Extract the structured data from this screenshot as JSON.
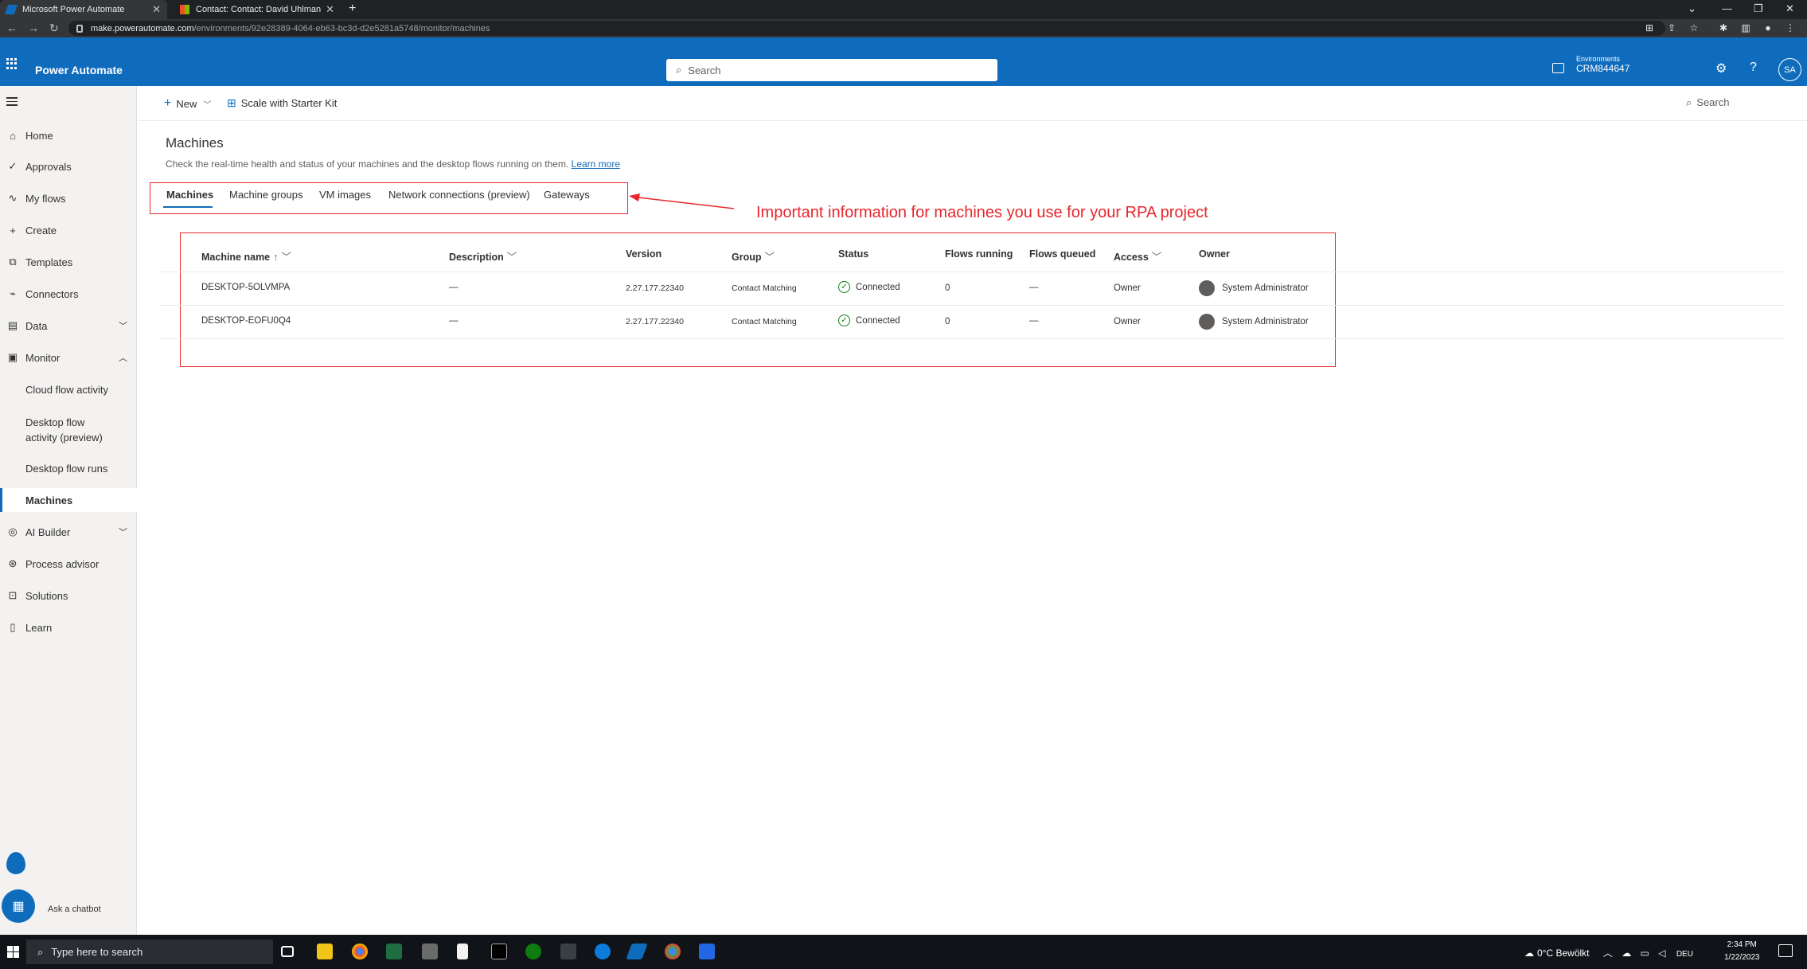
{
  "browser": {
    "tabs": [
      {
        "title": "Microsoft Power Automate",
        "active": true
      },
      {
        "title": "Contact: Contact: David Uhlmann",
        "active": false
      }
    ],
    "url_host": "make.powerautomate.com",
    "url_path": "/environments/92e28389-4064-eb63-bc3d-d2e5281a5748/monitor/machines"
  },
  "header": {
    "app_name": "Power Automate",
    "search_placeholder": "Search",
    "env_label": "Environments",
    "env_value": "CRM844647",
    "avatar_initials": "SA",
    "accent_color": "#0f6cbd"
  },
  "sidebar": {
    "items": [
      {
        "label": "Home",
        "icon": "home-icon"
      },
      {
        "label": "Approvals",
        "icon": "approvals-icon"
      },
      {
        "label": "My flows",
        "icon": "flows-icon"
      },
      {
        "label": "Create",
        "icon": "plus-icon"
      },
      {
        "label": "Templates",
        "icon": "templates-icon"
      },
      {
        "label": "Connectors",
        "icon": "connectors-icon"
      },
      {
        "label": "Data",
        "icon": "data-icon"
      },
      {
        "label": "Monitor",
        "icon": "monitor-icon"
      },
      {
        "label": "Cloud flow activity"
      },
      {
        "label": "Desktop flow activity (preview)"
      },
      {
        "label": "Desktop flow runs"
      },
      {
        "label": "Machines"
      },
      {
        "label": "AI Builder",
        "icon": "ai-builder-icon"
      },
      {
        "label": "Process advisor",
        "icon": "process-advisor-icon"
      },
      {
        "label": "Solutions",
        "icon": "solutions-icon"
      },
      {
        "label": "Learn",
        "icon": "learn-icon"
      }
    ],
    "chatbot_label": "Ask a chatbot"
  },
  "commandbar": {
    "new_label": "New",
    "starter_kit_label": "Scale with Starter Kit",
    "search_label": "Search"
  },
  "main": {
    "title": "Machines",
    "subtitle": "Check the real-time health and status of your machines and the desktop flows running on them.",
    "learn_more": "Learn more",
    "tabs": [
      "Machines",
      "Machine groups",
      "VM images",
      "Network connections (preview)",
      "Gateways"
    ],
    "annotation": "Important information for machines you use for your RPA project",
    "table": {
      "headers": [
        "Machine name",
        "Description",
        "Version",
        "Group",
        "Status",
        "Flows running",
        "Flows queued",
        "Access",
        "Owner"
      ],
      "rows": [
        {
          "name": "DESKTOP-5OLVMPA",
          "description": "—",
          "version": "2.27.177.22340",
          "group": "Contact Matching",
          "status": "Connected",
          "running": "0",
          "queued": "—",
          "access": "Owner",
          "owner": "System Administrator"
        },
        {
          "name": "DESKTOP-EOFU0Q4",
          "description": "—",
          "version": "2.27.177.22340",
          "group": "Contact Matching",
          "status": "Connected",
          "running": "0",
          "queued": "—",
          "access": "Owner",
          "owner": "System Administrator"
        }
      ]
    }
  },
  "taskbar": {
    "search_placeholder": "Type here to search",
    "weather": "0°C  Bewölkt",
    "lang": "DEU",
    "time": "2:34 PM",
    "date": "1/22/2023"
  }
}
